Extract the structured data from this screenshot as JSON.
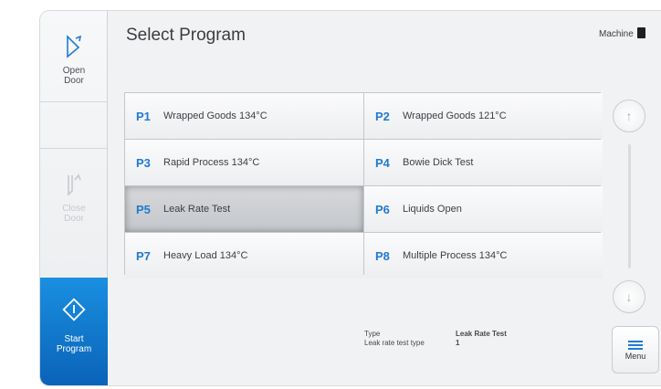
{
  "header": {
    "title": "Select Program",
    "machine_label": "Machine"
  },
  "sidebar": {
    "open_door": {
      "label": "Open\nDoor",
      "icon": "open-door-icon"
    },
    "close_door": {
      "label": "Close\nDoor",
      "icon": "close-door-icon",
      "enabled": false
    },
    "start_program": {
      "label": "Start\nProgram",
      "icon": "start-icon"
    }
  },
  "programs": [
    {
      "num": "P1",
      "name": "Wrapped Goods 134°C"
    },
    {
      "num": "P2",
      "name": "Wrapped Goods 121°C"
    },
    {
      "num": "P3",
      "name": "Rapid Process 134°C"
    },
    {
      "num": "P4",
      "name": "Bowie Dick Test"
    },
    {
      "num": "P5",
      "name": "Leak Rate Test",
      "selected": true
    },
    {
      "num": "P6",
      "name": "Liquids Open"
    },
    {
      "num": "P7",
      "name": "Heavy Load 134°C"
    },
    {
      "num": "P8",
      "name": "Multiple Process 134°C"
    }
  ],
  "info": {
    "type_label": "Type",
    "type_value": "Leak Rate Test",
    "subtype_label": "Leak rate test type",
    "subtype_value": "1"
  },
  "menu": {
    "label": "Menu"
  },
  "colors": {
    "accent": "#1f7bd1",
    "start_bg": "#0a63b8"
  }
}
